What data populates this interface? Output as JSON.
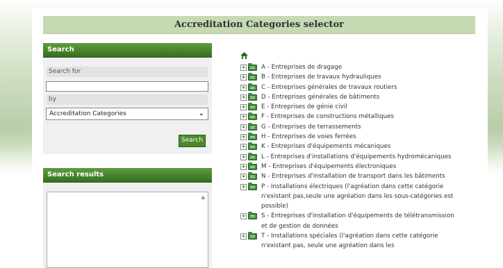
{
  "page": {
    "title": "Accreditation Categories selector"
  },
  "search_panel": {
    "header": "Search",
    "search_for_label": "Search for",
    "search_value": "",
    "by_label": "by",
    "by_selected": "Accreditation Categories",
    "button_label": "Search"
  },
  "results_panel": {
    "header": "Search results"
  },
  "tree": {
    "root_icon": "home-icon",
    "nodes": [
      {
        "label": "A - Entreprises de dragage"
      },
      {
        "label": "B - Entreprises de travaux hydrauliques"
      },
      {
        "label": "C - Entreprises générales de travaux routiers"
      },
      {
        "label": "D - Entreprises générales de bâtiments"
      },
      {
        "label": "E - Entreprises de génie civil"
      },
      {
        "label": "F - Entreprises de constructions métalliques"
      },
      {
        "label": "G - Entreprises de terrassements"
      },
      {
        "label": "H - Entreprises de voies ferrées"
      },
      {
        "label": "K - Entreprises d'équipements mécaniques"
      },
      {
        "label": "L - Entreprises d'installations d'équipements hydromécaniques"
      },
      {
        "label": "M - Entreprises d'équipements électroniques"
      },
      {
        "label": "N - Entreprises d'installation de transport dans les bâtiments"
      },
      {
        "label": "P - Installations électriques (l'agréation dans cette catégorie n'existant pas,seule une agréation dans les sous-catégories est possible)"
      },
      {
        "label": "S - Entreprises d'installation d'équipements de télétransmission et de gestion de données"
      },
      {
        "label": "T - Installations spéciales (l'agréation dans cette catégorie n'existant pas, seule une agréation dans les"
      }
    ]
  },
  "colors": {
    "accent_green": "#4a8a2c",
    "title_bar": "#c5d9b3",
    "folder_green": "#3f8a3a"
  }
}
